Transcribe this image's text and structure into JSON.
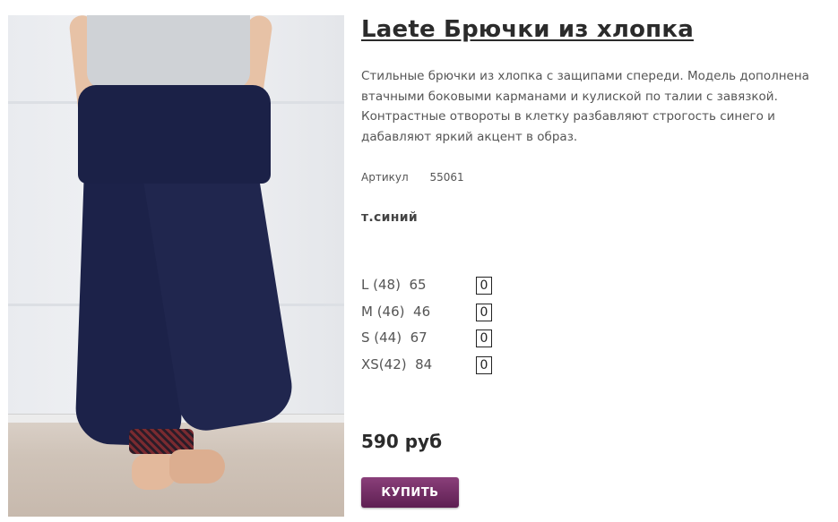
{
  "product": {
    "title": "Laete Брючки из хлопка",
    "description": "Стильные брючки из хлопка с защипами спереди. Модель дополнена втачными боковыми карманами и кулиской по талии с завязкой. Контрастные отвороты в клетку разбавляют строгость синего и дабавляют яркий акцент в образ.",
    "article_label": "Артикул",
    "article_value": "55061",
    "color": "т.синий",
    "sizes": [
      {
        "label": "L (48)  65",
        "qty": "0"
      },
      {
        "label": "M (46)  46",
        "qty": "0"
      },
      {
        "label": "S (44)  67",
        "qty": "0"
      },
      {
        "label": "XS(42)  84",
        "qty": "0"
      }
    ],
    "price": "590 руб",
    "buy_label": "КУПИТЬ"
  },
  "colors": {
    "buy_button": "#6e2a62",
    "pants": "#1c2249"
  }
}
